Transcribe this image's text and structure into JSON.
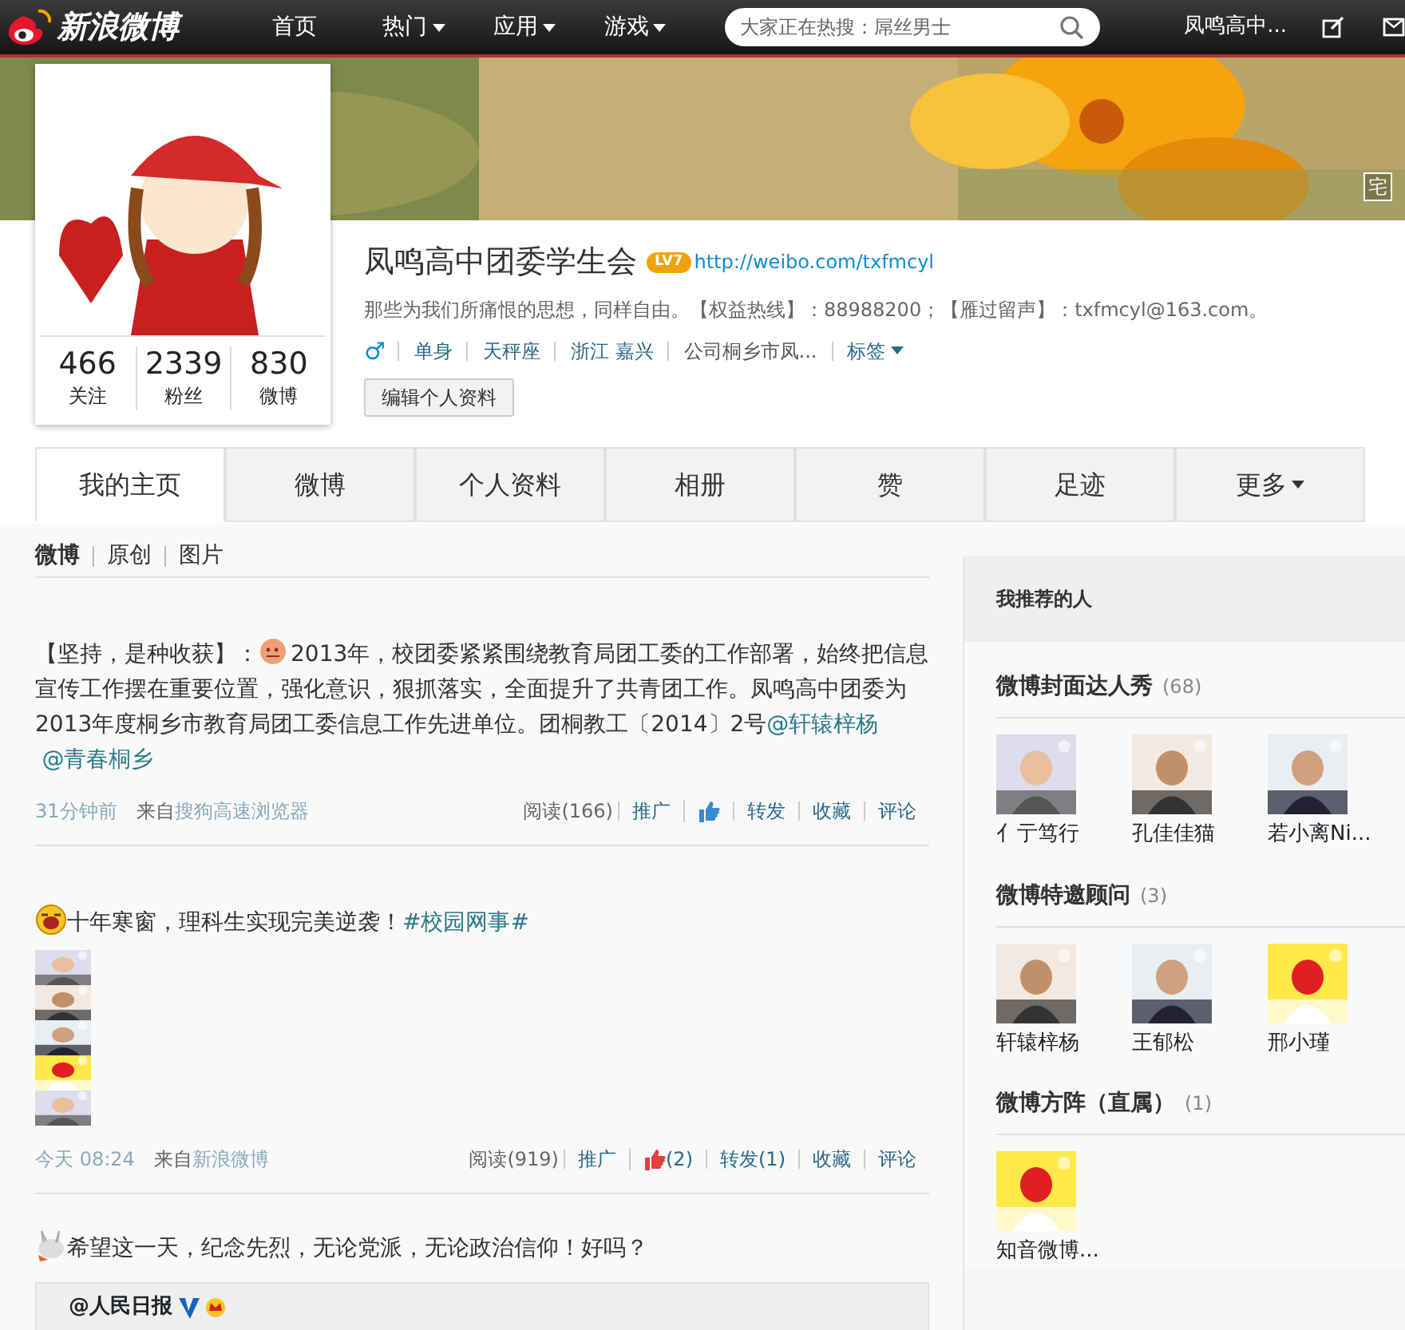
{
  "top_nav": {
    "logo": "新浪微博",
    "items": [
      {
        "label": "首页",
        "dropdown": false
      },
      {
        "label": "热门",
        "dropdown": true
      },
      {
        "label": "应用",
        "dropdown": true
      },
      {
        "label": "游戏",
        "dropdown": true
      }
    ],
    "search": {
      "placeholder": "大家正在热搜：屌丝男士"
    },
    "user": "凤鸣高中..."
  },
  "cover": {
    "badge": "宅"
  },
  "profile": {
    "stats": [
      {
        "value": "466",
        "label": "关注"
      },
      {
        "value": "2339",
        "label": "粉丝"
      },
      {
        "value": "830",
        "label": "微博"
      }
    ],
    "name": "凤鸣高中团委学生会",
    "level": "LV7",
    "url": "http://weibo.com/txfmcyl",
    "bio": "那些为我们所痛恨的思想，同样自由。【权益热线】：88988200；【雁过留声】：txfmcyl@163.com。",
    "gender": "♂",
    "tags": [
      "单身",
      "天秤座",
      "浙江 嘉兴",
      "公司桐乡市凤..."
    ],
    "tag_menu": "标签",
    "edit_button": "编辑个人资料"
  },
  "tabs": [
    {
      "label": "我的主页",
      "selected": true,
      "dropdown": false
    },
    {
      "label": "微博",
      "selected": false,
      "dropdown": false
    },
    {
      "label": "个人资料",
      "selected": false,
      "dropdown": false
    },
    {
      "label": "相册",
      "selected": false,
      "dropdown": false
    },
    {
      "label": "赞",
      "selected": false,
      "dropdown": false
    },
    {
      "label": "足迹",
      "selected": false,
      "dropdown": false
    },
    {
      "label": "更多",
      "selected": false,
      "dropdown": true
    }
  ],
  "feed_filters": [
    {
      "label": "微博",
      "selected": true
    },
    {
      "label": "原创",
      "selected": false
    },
    {
      "label": "图片",
      "selected": false
    }
  ],
  "posts": [
    {
      "segments": [
        {
          "kind": "text",
          "text": "【坚持，是种收获】："
        },
        {
          "kind": "emoticon"
        },
        {
          "kind": "text",
          "text": "2013年，校团委紧紧围绕教育局团工委的工作部署，始终把信息宣传工作摆在重要位置，强化意识，狠抓落实，全面提升了共青团工作。凤鸣高中团委为2013年度桐乡市教育局团工委信息工作先进单位。团桐教工〔2014〕2号"
        },
        {
          "kind": "link",
          "text": "@轩辕梓杨"
        },
        {
          "kind": "link",
          "text": "@青春桐乡"
        }
      ],
      "time": "31分钟前",
      "from": "来自",
      "source": "搜狗高速浏览器",
      "reads": "阅读(166)",
      "actions": [
        {
          "kind": "text",
          "label": "推广"
        },
        {
          "kind": "like"
        },
        {
          "kind": "text",
          "label": "转发"
        },
        {
          "kind": "text",
          "label": "收藏"
        },
        {
          "kind": "text",
          "label": "评论"
        }
      ]
    },
    {
      "segments": [
        {
          "kind": "laugh"
        },
        {
          "kind": "text",
          "text": "十年寒窗，理科生实现完美逆袭！"
        },
        {
          "kind": "link",
          "text": "#校园网事#"
        }
      ],
      "images": [
        {
          "kind": "picture"
        },
        {
          "kind": "picture"
        },
        {
          "kind": "picture"
        },
        {
          "kind": "picture"
        },
        {
          "kind": "picture"
        }
      ],
      "time": "今天 08:24",
      "from": "来自",
      "source": "新浪微博",
      "reads": "阅读(919)",
      "actions": [
        {
          "kind": "text",
          "label": "推广"
        },
        {
          "kind": "like",
          "label": "(2)"
        },
        {
          "kind": "text",
          "label": "转发(1)"
        },
        {
          "kind": "text",
          "label": "收藏"
        },
        {
          "kind": "text",
          "label": "评论"
        }
      ]
    },
    {
      "segments": [
        {
          "kind": "rabbit"
        },
        {
          "kind": "text",
          "text": "希望这一天，纪念先烈，无论党派，无论政治信仰！好吗？"
        }
      ],
      "quote": {
        "author": "@人民日报",
        "verified": true,
        "crown": true
      }
    }
  ],
  "sidebar": {
    "title": "我推荐的人",
    "sections": [
      {
        "title": "微博封面达人秀",
        "count": "(68)",
        "people": [
          "亻亍笃行",
          "孔佳佳猫",
          "若小离Ni..."
        ]
      },
      {
        "title": "微博特邀顾问",
        "count": "(3)",
        "people": [
          "轩辕梓杨",
          "王郁松",
          "邢小瑾"
        ]
      },
      {
        "title": "微博方阵（直属）",
        "count": "(1)",
        "people": [
          "知音微博..."
        ]
      }
    ]
  }
}
